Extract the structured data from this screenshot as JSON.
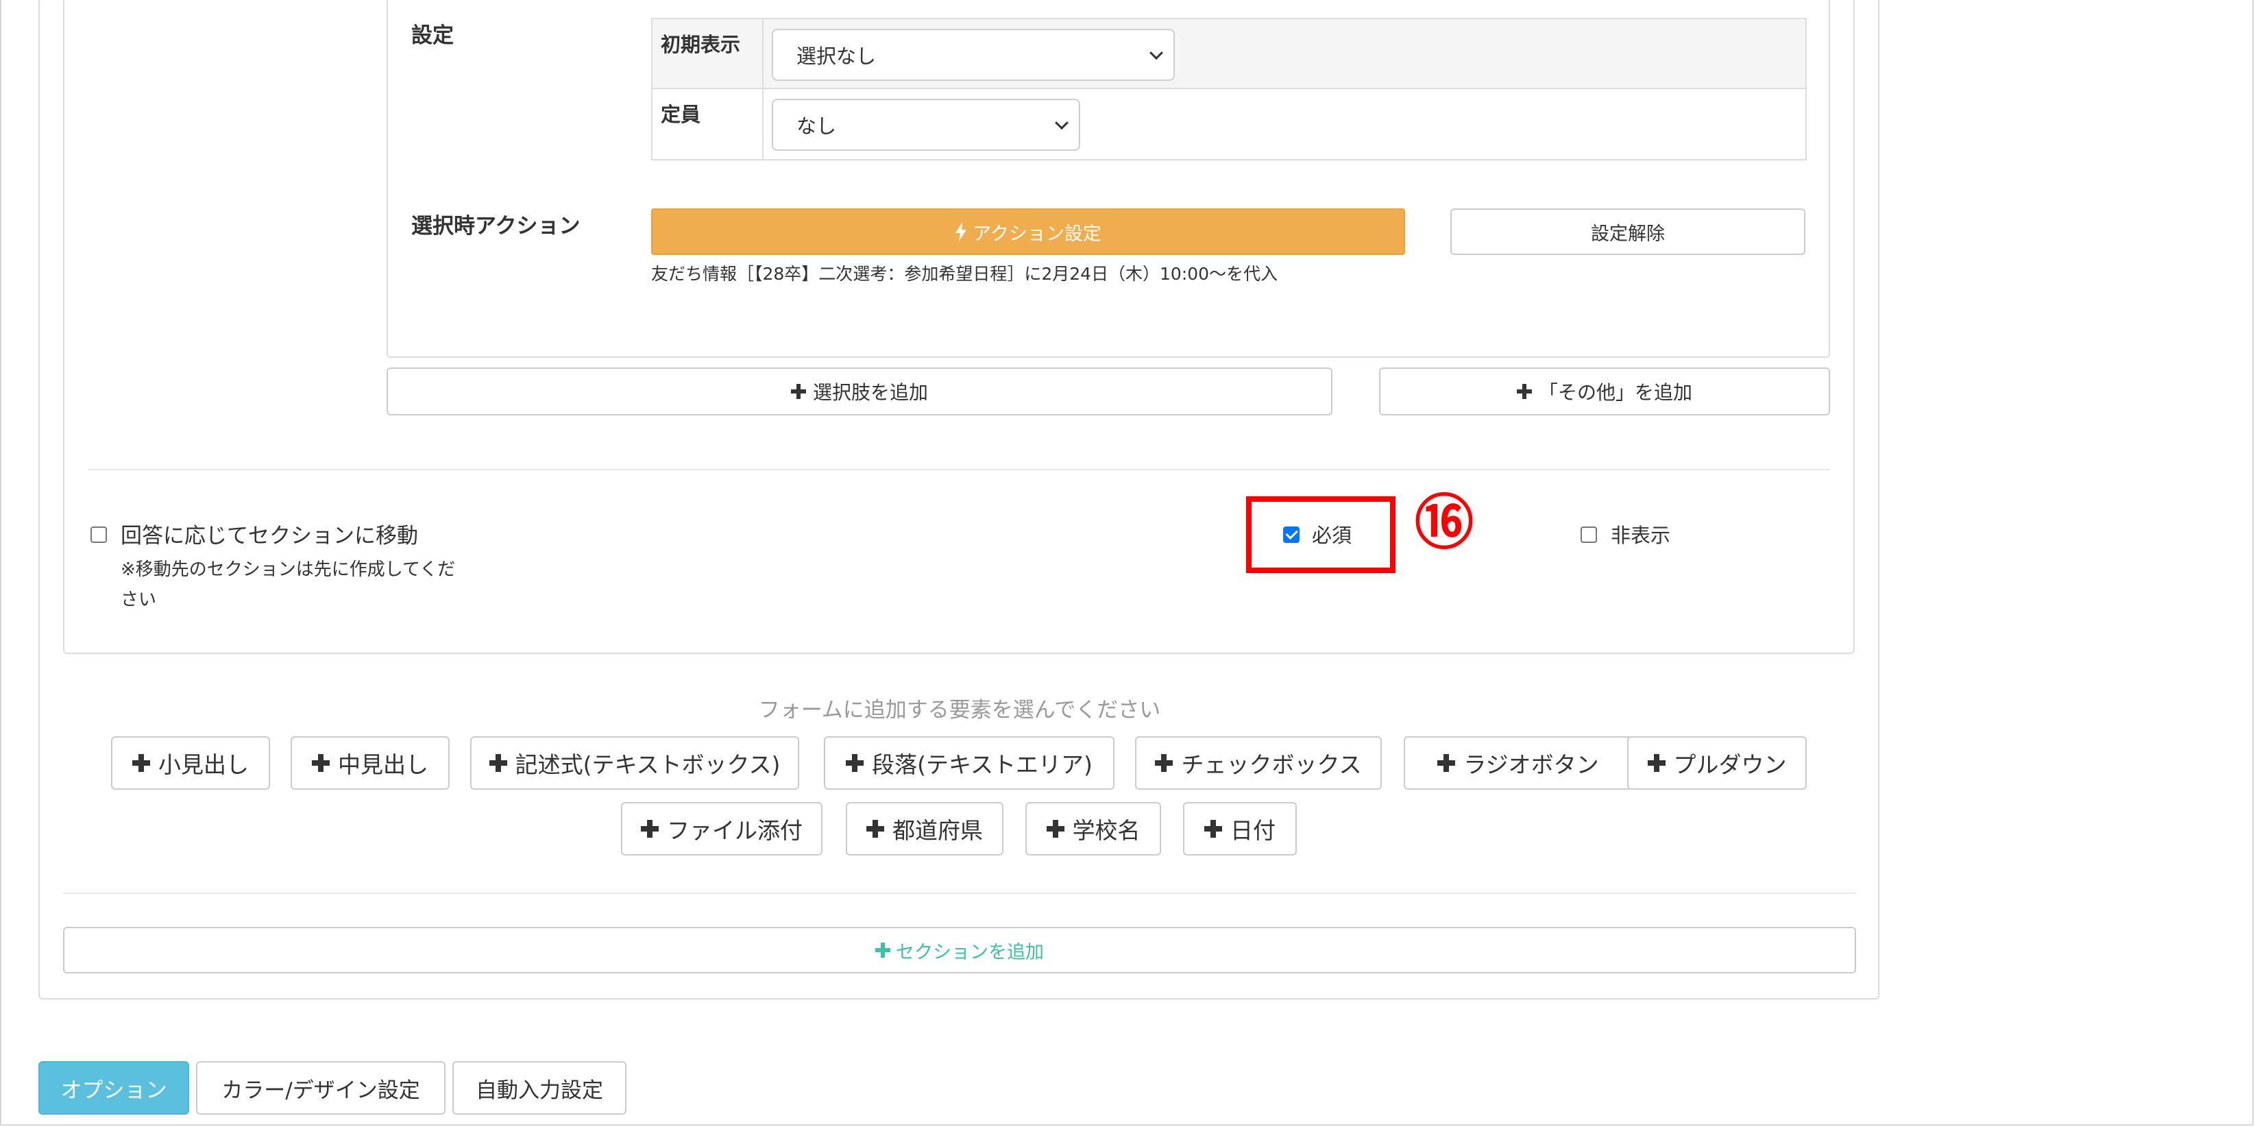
{
  "settings": {
    "label": "設定",
    "initial_display_label": "初期表示",
    "initial_display_value": "選択なし",
    "capacity_label": "定員",
    "capacity_value": "なし"
  },
  "action": {
    "label": "選択時アクション",
    "action_button": "アクション設定",
    "clear_button": "設定解除",
    "note": "友だち情報［【28卒】二次選考：参加希望日程］に2月24日（木）10:00〜を代入"
  },
  "choices": {
    "add_choice": "選択肢を追加",
    "add_other": "「その他」を追加"
  },
  "question_options": {
    "move_section_label": "回答に応じてセクションに移動",
    "move_section_note_line1": "※移動先のセクションは先に作成してくだ",
    "move_section_note_line2": "さい",
    "required_label": "必須",
    "required_checked": true,
    "hidden_label": "非表示",
    "hidden_checked": false,
    "annotation_number": "⑯",
    "annotation_color": "#ff0000"
  },
  "add_elements": {
    "hint": "フォームに追加する要素を選んでください",
    "row1": [
      "小見出し",
      "中見出し",
      "記述式(テキストボックス)",
      "段落(テキストエリア)",
      "チェックボックス",
      "ラジオボタン",
      "プルダウン"
    ],
    "row2": [
      "ファイル添付",
      "都道府県",
      "学校名",
      "日付"
    ]
  },
  "add_section": "セクションを追加",
  "bottom_tabs": {
    "options": "オプション",
    "color_design": "カラー/デザイン設定",
    "auto_input": "自動入力設定"
  },
  "colors": {
    "warning": "#f0ad4e",
    "info": "#5bc0de",
    "success_text": "#3cc0a8"
  }
}
